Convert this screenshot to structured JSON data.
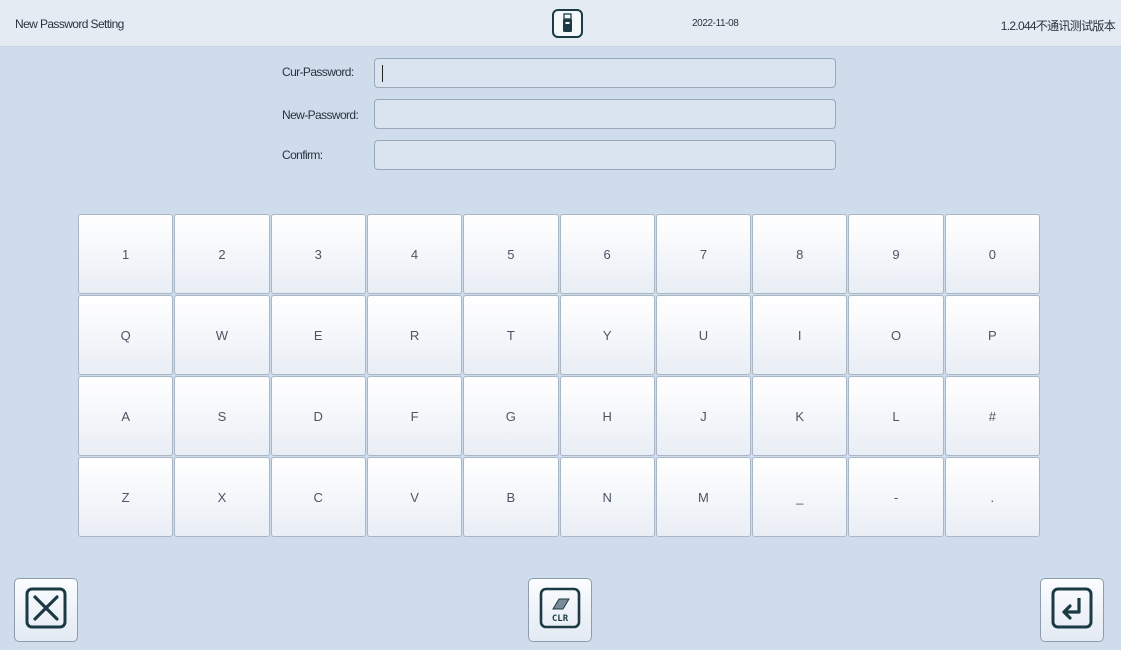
{
  "header": {
    "title": "New Password Setting",
    "usb_icon": "usb-drive-icon",
    "date": "2022-11-08",
    "version": "1.2.044不通讯测试版本"
  },
  "form": {
    "cur_label": "Cur-Password:",
    "new_label": "New-Password:",
    "confirm_label": "Confirm:",
    "cur_value": "",
    "new_value": "",
    "confirm_value": ""
  },
  "keyboard": {
    "rows": [
      [
        "1",
        "2",
        "3",
        "4",
        "5",
        "6",
        "7",
        "8",
        "9",
        "0"
      ],
      [
        "Q",
        "W",
        "E",
        "R",
        "T",
        "Y",
        "U",
        "I",
        "O",
        "P"
      ],
      [
        "A",
        "S",
        "D",
        "F",
        "G",
        "H",
        "J",
        "K",
        "L",
        "#"
      ],
      [
        "Z",
        "X",
        "C",
        "V",
        "B",
        "N",
        "M",
        "_",
        "-",
        "."
      ]
    ]
  },
  "footer": {
    "cancel_icon": "close-icon",
    "clear_label": "CLR",
    "clear_icon": "eraser-icon",
    "enter_icon": "enter-icon"
  }
}
